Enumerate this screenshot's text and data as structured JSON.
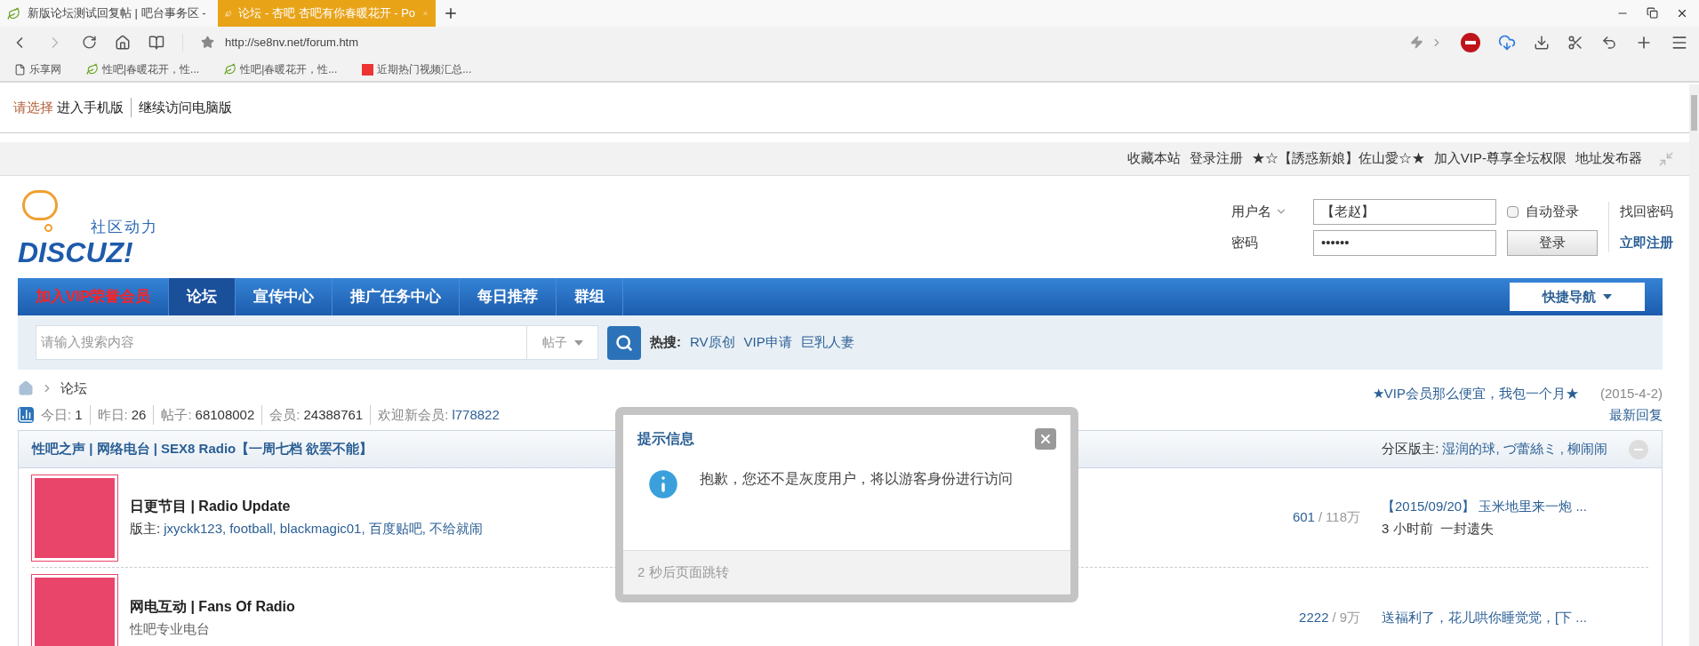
{
  "browser": {
    "tabs": [
      {
        "title": "新版论坛测试回复帖 | 吧台事务区 -",
        "selected": false
      },
      {
        "title": "论坛 - 杏吧 杏吧有你春暖花开 - Po",
        "selected": true
      }
    ],
    "address": "http://se8nv.net/forum.htm",
    "bookmarks": [
      {
        "label": "乐享网",
        "kind": "page"
      },
      {
        "label": "性吧|春暖花开，性...",
        "kind": "site"
      },
      {
        "label": "性吧|春暖花开，性...",
        "kind": "site"
      },
      {
        "label": "近期热门视频汇总...",
        "kind": "fu"
      }
    ]
  },
  "notice": {
    "prefix": "请选择",
    "links": [
      "进入手机版",
      "继续访问电脑版"
    ]
  },
  "topbar": [
    "收藏本站",
    "登录注册",
    "★☆【誘惑新娘】佐山愛☆★",
    "加入VIP-尊享全坛权限",
    "地址发布器"
  ],
  "logo": {
    "tagline": "社区动力",
    "name": "DISCUZ!"
  },
  "login": {
    "username_label": "用户名",
    "username_value": "【老赵】",
    "password_label": "密码",
    "password_value": "••••••",
    "auto_login_label": "自动登录",
    "auto_login_checked": false,
    "login_button": "登录",
    "forgot": "找回密码",
    "register": "立即注册"
  },
  "nav": {
    "items": [
      {
        "label": "加入VIP荣誉会员",
        "kind": "vip",
        "selected": false
      },
      {
        "label": "论坛",
        "kind": "normal",
        "selected": true
      },
      {
        "label": "宣传中心",
        "kind": "normal",
        "selected": false
      },
      {
        "label": "推广任务中心",
        "kind": "normal",
        "selected": false
      },
      {
        "label": "每日推荐",
        "kind": "normal",
        "selected": false
      },
      {
        "label": "群组",
        "kind": "normal",
        "selected": false
      }
    ],
    "quick_nav": "快捷导航"
  },
  "search": {
    "placeholder": "请输入搜索内容",
    "type": "帖子",
    "hot_label": "热搜:",
    "hot": [
      "RV原创",
      "VIP申请",
      "巨乳人妻"
    ]
  },
  "breadcrumb": "论坛",
  "announcement": {
    "text": "★VIP会员那么便宜，我包一个月★",
    "date": "(2015-4-2)"
  },
  "latest_reply": "最新回复",
  "stats": [
    {
      "label": "今日:",
      "value": "1"
    },
    {
      "label": "昨日:",
      "value": "26"
    },
    {
      "label": "帖子:",
      "value": "68108002"
    },
    {
      "label": "会员:",
      "value": "24388761"
    },
    {
      "label": "欢迎新会员:",
      "value": "l778822"
    }
  ],
  "section": {
    "title": "性吧之声 | 网络电台 | SEX8 Radio【一周七档 欲罢不能】",
    "moderators_label": "分区版主:",
    "moderators": [
      "湿润的球,",
      "づ蕾絲ミ ,",
      "柳闹闹"
    ]
  },
  "count_separator": "/",
  "forums": [
    {
      "name": "日更节目 | Radio Update",
      "moderators_label": "版主:",
      "moderators": [
        "jxyckk123,",
        "football,",
        "blackmagic01,",
        "百度贴吧,",
        "不给就闹"
      ],
      "threads": "601",
      "posts": "118万",
      "last_title": "【2015/09/20】 玉米地里来一炮 ...",
      "last_time": "3 小时前",
      "last_user": "一封遗失"
    },
    {
      "name": "网电互动 | Fans Of Radio",
      "description": "性吧专业电台",
      "threads": "2222",
      "posts": "9万",
      "last_title": "送福利了，花儿哄你睡觉觉，[下 ..."
    }
  ],
  "dialog": {
    "title": "提示信息",
    "message": "抱歉，您还不是灰度用户，将以游客身份进行访问",
    "footer": "2 秒后页面跳转"
  }
}
